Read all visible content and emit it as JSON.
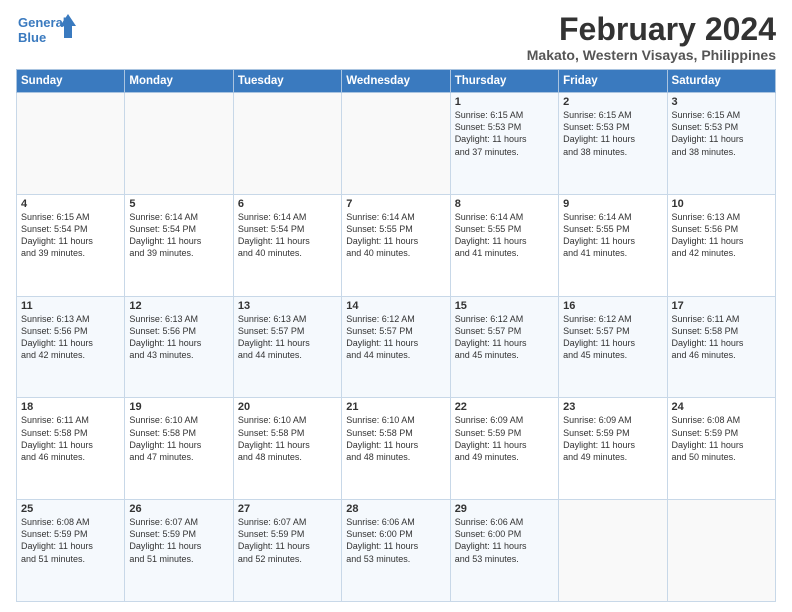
{
  "logo": {
    "line1": "General",
    "line2": "Blue"
  },
  "title": {
    "month_year": "February 2024",
    "location": "Makato, Western Visayas, Philippines"
  },
  "weekdays": [
    "Sunday",
    "Monday",
    "Tuesday",
    "Wednesday",
    "Thursday",
    "Friday",
    "Saturday"
  ],
  "weeks": [
    [
      {
        "day": "",
        "info": ""
      },
      {
        "day": "",
        "info": ""
      },
      {
        "day": "",
        "info": ""
      },
      {
        "day": "",
        "info": ""
      },
      {
        "day": "1",
        "info": "Sunrise: 6:15 AM\nSunset: 5:53 PM\nDaylight: 11 hours\nand 37 minutes."
      },
      {
        "day": "2",
        "info": "Sunrise: 6:15 AM\nSunset: 5:53 PM\nDaylight: 11 hours\nand 38 minutes."
      },
      {
        "day": "3",
        "info": "Sunrise: 6:15 AM\nSunset: 5:53 PM\nDaylight: 11 hours\nand 38 minutes."
      }
    ],
    [
      {
        "day": "4",
        "info": "Sunrise: 6:15 AM\nSunset: 5:54 PM\nDaylight: 11 hours\nand 39 minutes."
      },
      {
        "day": "5",
        "info": "Sunrise: 6:14 AM\nSunset: 5:54 PM\nDaylight: 11 hours\nand 39 minutes."
      },
      {
        "day": "6",
        "info": "Sunrise: 6:14 AM\nSunset: 5:54 PM\nDaylight: 11 hours\nand 40 minutes."
      },
      {
        "day": "7",
        "info": "Sunrise: 6:14 AM\nSunset: 5:55 PM\nDaylight: 11 hours\nand 40 minutes."
      },
      {
        "day": "8",
        "info": "Sunrise: 6:14 AM\nSunset: 5:55 PM\nDaylight: 11 hours\nand 41 minutes."
      },
      {
        "day": "9",
        "info": "Sunrise: 6:14 AM\nSunset: 5:55 PM\nDaylight: 11 hours\nand 41 minutes."
      },
      {
        "day": "10",
        "info": "Sunrise: 6:13 AM\nSunset: 5:56 PM\nDaylight: 11 hours\nand 42 minutes."
      }
    ],
    [
      {
        "day": "11",
        "info": "Sunrise: 6:13 AM\nSunset: 5:56 PM\nDaylight: 11 hours\nand 42 minutes."
      },
      {
        "day": "12",
        "info": "Sunrise: 6:13 AM\nSunset: 5:56 PM\nDaylight: 11 hours\nand 43 minutes."
      },
      {
        "day": "13",
        "info": "Sunrise: 6:13 AM\nSunset: 5:57 PM\nDaylight: 11 hours\nand 44 minutes."
      },
      {
        "day": "14",
        "info": "Sunrise: 6:12 AM\nSunset: 5:57 PM\nDaylight: 11 hours\nand 44 minutes."
      },
      {
        "day": "15",
        "info": "Sunrise: 6:12 AM\nSunset: 5:57 PM\nDaylight: 11 hours\nand 45 minutes."
      },
      {
        "day": "16",
        "info": "Sunrise: 6:12 AM\nSunset: 5:57 PM\nDaylight: 11 hours\nand 45 minutes."
      },
      {
        "day": "17",
        "info": "Sunrise: 6:11 AM\nSunset: 5:58 PM\nDaylight: 11 hours\nand 46 minutes."
      }
    ],
    [
      {
        "day": "18",
        "info": "Sunrise: 6:11 AM\nSunset: 5:58 PM\nDaylight: 11 hours\nand 46 minutes."
      },
      {
        "day": "19",
        "info": "Sunrise: 6:10 AM\nSunset: 5:58 PM\nDaylight: 11 hours\nand 47 minutes."
      },
      {
        "day": "20",
        "info": "Sunrise: 6:10 AM\nSunset: 5:58 PM\nDaylight: 11 hours\nand 48 minutes."
      },
      {
        "day": "21",
        "info": "Sunrise: 6:10 AM\nSunset: 5:58 PM\nDaylight: 11 hours\nand 48 minutes."
      },
      {
        "day": "22",
        "info": "Sunrise: 6:09 AM\nSunset: 5:59 PM\nDaylight: 11 hours\nand 49 minutes."
      },
      {
        "day": "23",
        "info": "Sunrise: 6:09 AM\nSunset: 5:59 PM\nDaylight: 11 hours\nand 49 minutes."
      },
      {
        "day": "24",
        "info": "Sunrise: 6:08 AM\nSunset: 5:59 PM\nDaylight: 11 hours\nand 50 minutes."
      }
    ],
    [
      {
        "day": "25",
        "info": "Sunrise: 6:08 AM\nSunset: 5:59 PM\nDaylight: 11 hours\nand 51 minutes."
      },
      {
        "day": "26",
        "info": "Sunrise: 6:07 AM\nSunset: 5:59 PM\nDaylight: 11 hours\nand 51 minutes."
      },
      {
        "day": "27",
        "info": "Sunrise: 6:07 AM\nSunset: 5:59 PM\nDaylight: 11 hours\nand 52 minutes."
      },
      {
        "day": "28",
        "info": "Sunrise: 6:06 AM\nSunset: 6:00 PM\nDaylight: 11 hours\nand 53 minutes."
      },
      {
        "day": "29",
        "info": "Sunrise: 6:06 AM\nSunset: 6:00 PM\nDaylight: 11 hours\nand 53 minutes."
      },
      {
        "day": "",
        "info": ""
      },
      {
        "day": "",
        "info": ""
      }
    ]
  ]
}
